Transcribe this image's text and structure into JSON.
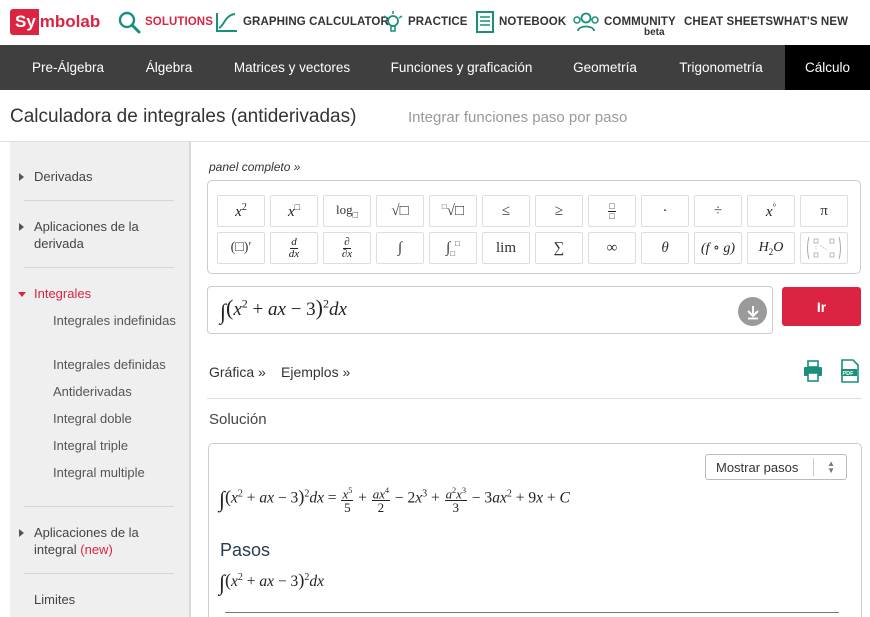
{
  "logo": {
    "sy": "Sy",
    "rest": "mbolab"
  },
  "topnav": {
    "solutions": "SOLUTIONS",
    "graphing": "GRAPHING CALCULATOR",
    "practice": "PRACTICE",
    "notebook": "NOTEBOOK",
    "community": "COMMUNITY",
    "community_badge": "beta",
    "cheat_sheets": "CHEAT SHEETS",
    "whats_new": "WHAT'S NEW"
  },
  "categories": [
    "Pre-Álgebra",
    "Álgebra",
    "Matrices y vectores",
    "Funciones y graficación",
    "Geometría",
    "Trigonometría",
    "Cálculo"
  ],
  "page": {
    "title": "Calculadora de integrales (antiderivadas)",
    "subtitle": "Integrar funciones paso por paso"
  },
  "sidebar": {
    "derivadas": "Derivadas",
    "aplicaciones_derivada": "Aplicaciones de la derivada",
    "integrales": "Integrales",
    "sub": [
      "Integrales indefinidas",
      "Integrales definidas",
      "Antiderivadas",
      "Integral doble",
      "Integral triple",
      "Integral multiple"
    ],
    "aplicaciones_integral": "Aplicaciones de la integral",
    "new_tag": "(new)",
    "limites": "Limites"
  },
  "panel_link": "panel completo »",
  "keypad": {
    "lim": "lim",
    "dots": "·",
    "divide": "÷",
    "pi": "π",
    "leq": "≤",
    "geq": "≥",
    "sum": "∑",
    "inf": "∞",
    "theta": "θ",
    "integral": "∫"
  },
  "input": {
    "expression": "∫(x² + ax − 3)²dx"
  },
  "go_button": "Ir",
  "links": {
    "graph": "Gráfica »",
    "examples": "Ejemplos »"
  },
  "solution": {
    "label": "Solución",
    "show_steps": "Mostrar pasos",
    "steps_title": "Pasos"
  },
  "colors": {
    "accent": "#dc2442",
    "catbar": "#3f3f3f",
    "sidebar": "#efefef"
  }
}
